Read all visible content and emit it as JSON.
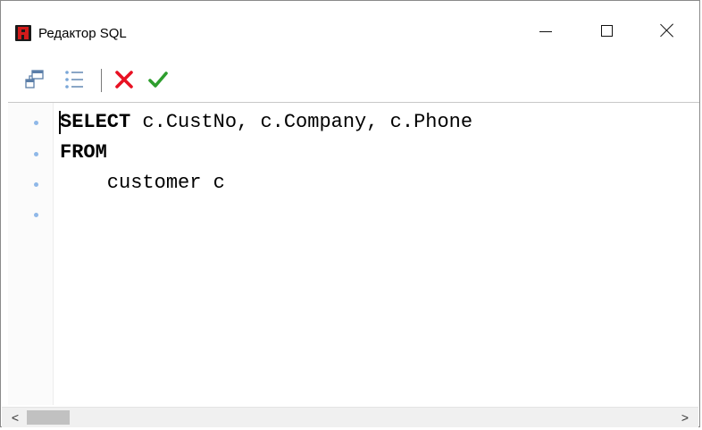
{
  "window": {
    "title": "Редактор SQL",
    "controls": {
      "minimize": "minimize",
      "maximize": "maximize",
      "close": "close"
    }
  },
  "toolbar": {
    "buttons": [
      {
        "name": "query-builder-icon"
      },
      {
        "name": "list-icon"
      },
      {
        "name": "cancel-x-icon",
        "color": "#e81123"
      },
      {
        "name": "ok-check-icon",
        "color": "#2e9e2e"
      }
    ]
  },
  "editor": {
    "lines": [
      {
        "keyword": "SELECT",
        "rest": " c.CustNo, c.Company, c.Phone"
      },
      {
        "keyword": "FROM",
        "rest": ""
      },
      {
        "keyword": "",
        "rest": "    customer c"
      },
      {
        "keyword": "",
        "rest": ""
      }
    ]
  },
  "scrollbar": {
    "left_arrow": "<",
    "right_arrow": ">"
  }
}
